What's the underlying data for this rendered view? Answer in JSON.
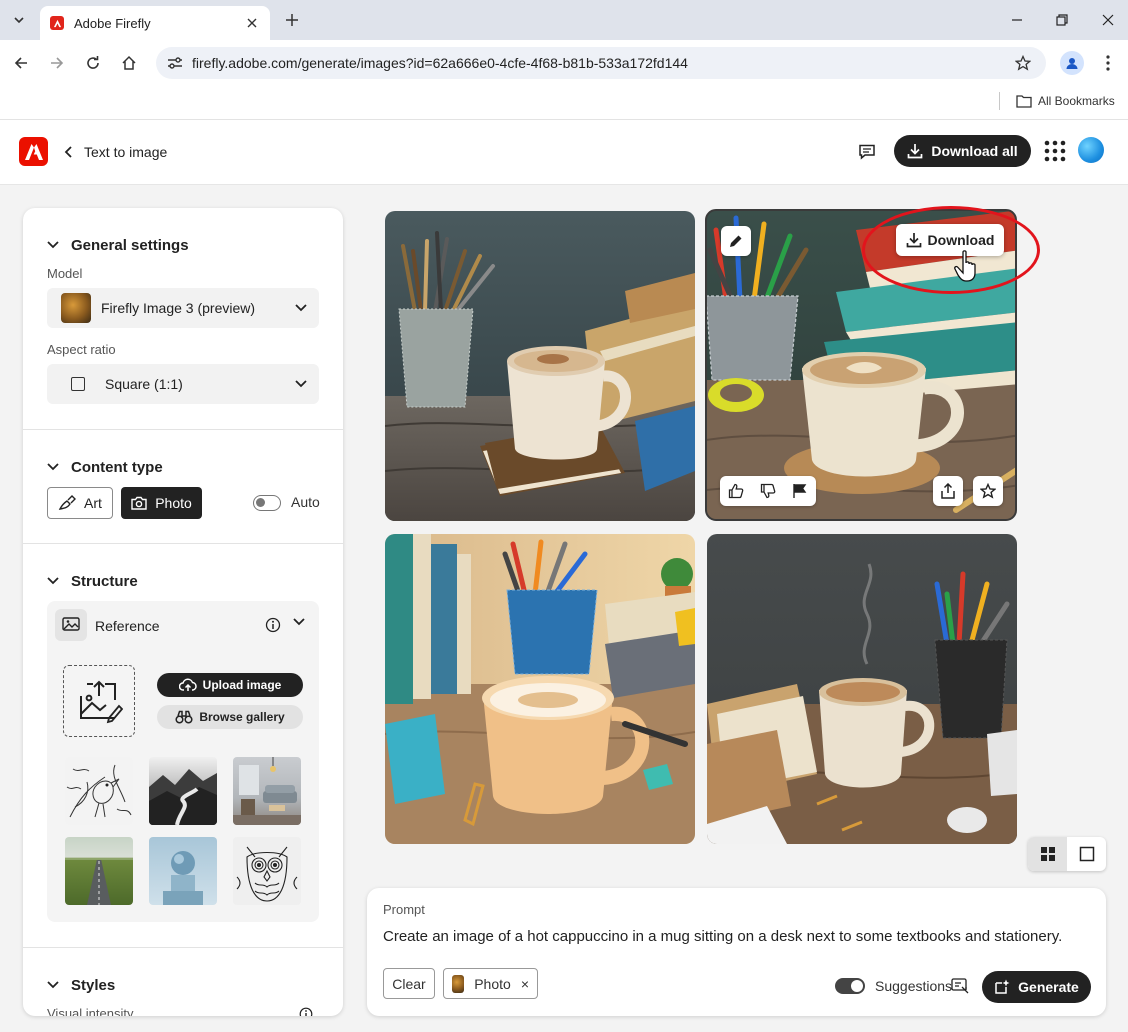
{
  "browser": {
    "tab_title": "Adobe Firefly",
    "url": "firefly.adobe.com/generate/images?id=62a666e0-4cfe-4f68-b81b-533a172fd144",
    "bookmarks_label": "All Bookmarks"
  },
  "header": {
    "back_label": "Text to image",
    "download_all_label": "Download all"
  },
  "panel": {
    "general": {
      "title": "General settings",
      "model_label": "Model",
      "model_value": "Firefly Image 3 (preview)",
      "aspect_label": "Aspect ratio",
      "aspect_value": "Square (1:1)"
    },
    "content_type": {
      "title": "Content type",
      "art_label": "Art",
      "photo_label": "Photo",
      "auto_label": "Auto",
      "selected": "Photo"
    },
    "structure": {
      "title": "Structure",
      "reference_label": "Reference",
      "upload_label": "Upload image",
      "browse_label": "Browse gallery",
      "thumbnails": [
        "bird-sketch",
        "mountain-river",
        "living-room",
        "road-field",
        "sphere-pedestal",
        "owl-drawing"
      ]
    },
    "styles": {
      "title": "Styles",
      "visual_intensity_label": "Visual intensity"
    }
  },
  "results": {
    "download_label": "Download",
    "images": [
      "cappuccino-1",
      "cappuccino-2",
      "cappuccino-3",
      "cappuccino-4"
    ],
    "selected_index": 1
  },
  "prompt": {
    "label": "Prompt",
    "text": "Create an image of a hot cappuccino in a mug sitting on a desk next to some textbooks and stationery.",
    "clear_label": "Clear",
    "chip_label": "Photo",
    "suggestions_label": "Suggestions",
    "suggestions_on": true,
    "generate_label": "Generate"
  },
  "colors": {
    "accent_dark": "#222222",
    "adobe_red": "#eb1000",
    "highlight_red": "#e2141c"
  }
}
